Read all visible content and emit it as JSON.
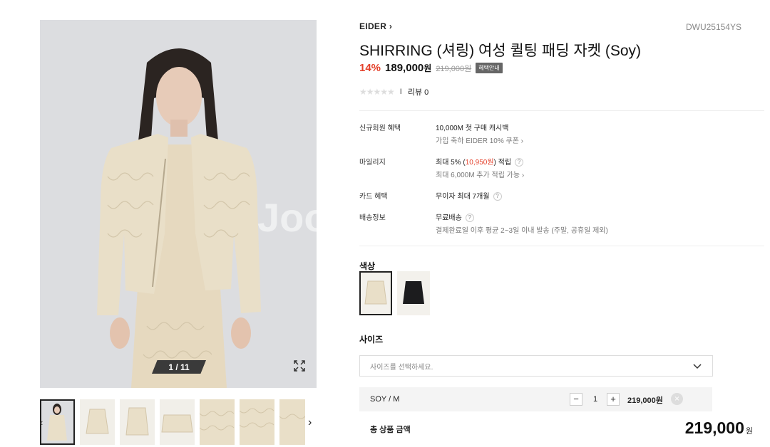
{
  "gallery": {
    "watermark": "Joo",
    "pager": "1 / 11",
    "thumbnails": [
      "thumb-1",
      "thumb-2",
      "thumb-3",
      "thumb-4",
      "thumb-5",
      "thumb-6",
      "thumb-7"
    ]
  },
  "product": {
    "brand": "EIDER",
    "code": "DWU25154YS",
    "title": "SHIRRING (셔링) 여성 퀼팅 패딩 자켓 (Soy)",
    "discount": "14%",
    "price": "189,000",
    "price_unit": "원",
    "original_price": "219,000원",
    "benefit_badge": "혜택안내",
    "review_label": "리뷰 0"
  },
  "benefits": [
    {
      "label": "신규회원 혜택",
      "main": "10,000M 첫 구매 캐시백",
      "sub": "가입 축하 EIDER 10% 쿠폰"
    },
    {
      "label": "마일리지",
      "main_pre": "최대 5% (",
      "main_highlight": "10,950원",
      "main_post": ") 적립",
      "sub": "최대 6,000M 추가 적립 가능"
    },
    {
      "label": "카드 혜택",
      "main": "무이자 최대 7개월"
    },
    {
      "label": "배송정보",
      "main": "무료배송",
      "sub": "결제완료일 이후 평균 2~3일 이내 발송 (주말, 공휴일 제외)"
    }
  ],
  "color": {
    "title": "색상",
    "swatches": [
      {
        "name": "Soy",
        "hex": "#e9dfc8",
        "selected": true
      },
      {
        "name": "Black",
        "hex": "#1c1c1e",
        "selected": false
      }
    ]
  },
  "size": {
    "title": "사이즈",
    "placeholder": "사이즈를 선택하세요."
  },
  "selected_option": {
    "name": "SOY / M",
    "quantity": "1",
    "price": "219,000원"
  },
  "total": {
    "label": "총 상품 금액",
    "amount": "219,000",
    "unit": "원"
  },
  "colors": {
    "accent_red": "#e4412b",
    "jacket_beige": "#e9dfc8",
    "photo_bg": "#dcdde0"
  }
}
